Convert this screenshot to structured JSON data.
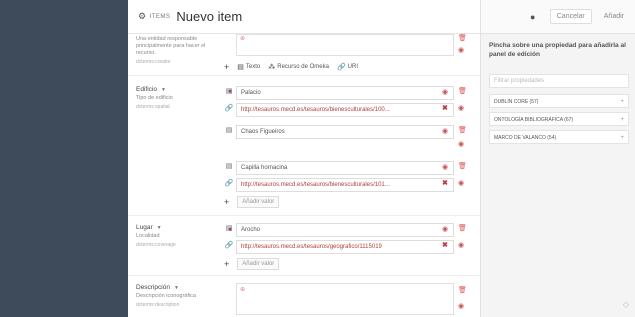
{
  "header": {
    "items_badge": "ITEMS",
    "title": "Nuevo item"
  },
  "right_panel": {
    "cancel_label": "Cancelar",
    "add_label": "Añadir",
    "hint": "Pincha sobre una propiedad para añadirla al panel de edición",
    "filter_placeholder": "Filtrar propiedades",
    "vocabularies": [
      {
        "label": "DUBLIN CORE (57)"
      },
      {
        "label": "ONTOLOGÍA BIBLIOGRÁFICA (67)"
      },
      {
        "label": "MARCO DE VALANCO (54)"
      }
    ]
  },
  "props": {
    "p0": {
      "sub": "Una entidad responsable principalmente para hacer el recurso.",
      "term": "dcterms:creator",
      "add_text": "Texto",
      "add_resource": "Recurso de Omeka",
      "add_uri": "URI"
    },
    "edificio": {
      "label": "Edificio",
      "sub": "Tipo de edificio",
      "term": "dcterms:spatial",
      "values": [
        {
          "kind": "text",
          "value": "Palacio"
        },
        {
          "kind": "uri",
          "value": "http://tesauros.mecd.es/tesauros/bienesculturales/100..."
        },
        {
          "kind": "text",
          "value": "Chaos Figueiros"
        },
        {
          "kind": "text",
          "value": "Capilla hornacina"
        },
        {
          "kind": "uri",
          "value": "http://tesauros.mecd.es/tesauros/bienesculturales/101..."
        }
      ],
      "add_value": "Añadir valor"
    },
    "lugar": {
      "label": "Lugar",
      "sub": "Localidad",
      "term": "dcterms:coverage",
      "values": [
        {
          "kind": "text",
          "value": "Arocho"
        },
        {
          "kind": "uri",
          "value": "http://tesauros.mecd.es/tesauros/geografico/1115019"
        }
      ],
      "add_value": "Añadir valor"
    },
    "descripcion": {
      "label": "Descripción",
      "sub": "Descripción iconográfica",
      "term": "dcterms:description"
    }
  }
}
